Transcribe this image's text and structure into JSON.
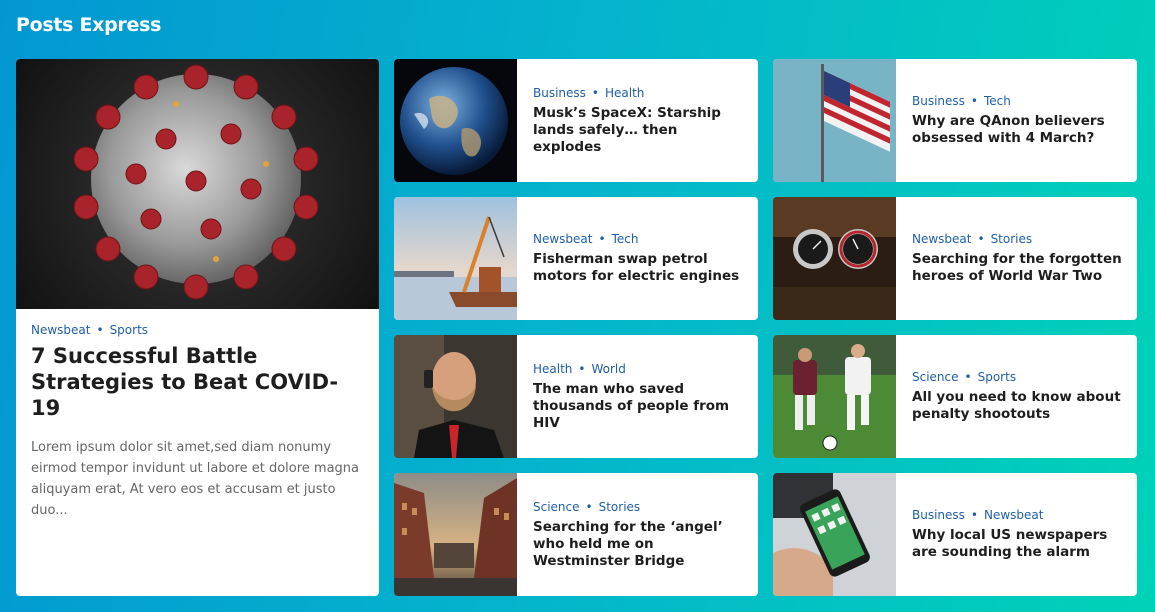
{
  "site": {
    "title": "Posts Express"
  },
  "featured": {
    "image_icon": "coronavirus-image",
    "categories": [
      "Newsbeat",
      "Sports"
    ],
    "title": "7 Successful Battle Strategies to Beat COVID-19",
    "excerpt": "Lorem ipsum dolor sit amet,sed diam nonumy eirmod tempor invidunt ut labore et dolore magna aliquyam erat, At vero eos et accusam et justo duo..."
  },
  "posts": [
    {
      "image_icon": "earth-image",
      "categories": [
        "Business",
        "Health"
      ],
      "title": "Musk’s SpaceX: Starship lands safely… then explodes"
    },
    {
      "image_icon": "flag-image",
      "categories": [
        "Business",
        "Tech"
      ],
      "title": "Why are QAnon believers obsessed with 4 March?"
    },
    {
      "image_icon": "ship-harbor-image",
      "categories": [
        "Newsbeat",
        "Tech"
      ],
      "title": "Fisherman swap petrol motors for electric engines"
    },
    {
      "image_icon": "watches-image",
      "categories": [
        "Newsbeat",
        "Stories"
      ],
      "title": "Searching for the forgotten heroes of World War Two"
    },
    {
      "image_icon": "bearded-man-phone-image",
      "categories": [
        "Health",
        "World"
      ],
      "title": "The man who saved thousands of people from HIV"
    },
    {
      "image_icon": "soccer-players-image",
      "categories": [
        "Science",
        "Sports"
      ],
      "title": "All you need to know about penalty shootouts"
    },
    {
      "image_icon": "canal-buildings-image",
      "categories": [
        "Science",
        "Stories"
      ],
      "title": "Searching for the ‘angel’ who held me on Westminster Bridge"
    },
    {
      "image_icon": "smartphone-hand-image",
      "categories": [
        "Business",
        "Newsbeat"
      ],
      "title": "Why local US newspapers are sounding the alarm"
    }
  ],
  "colors": {
    "accent": "#1f5fa8",
    "gradient_start": "#0397d2",
    "gradient_end": "#00d2b8"
  }
}
